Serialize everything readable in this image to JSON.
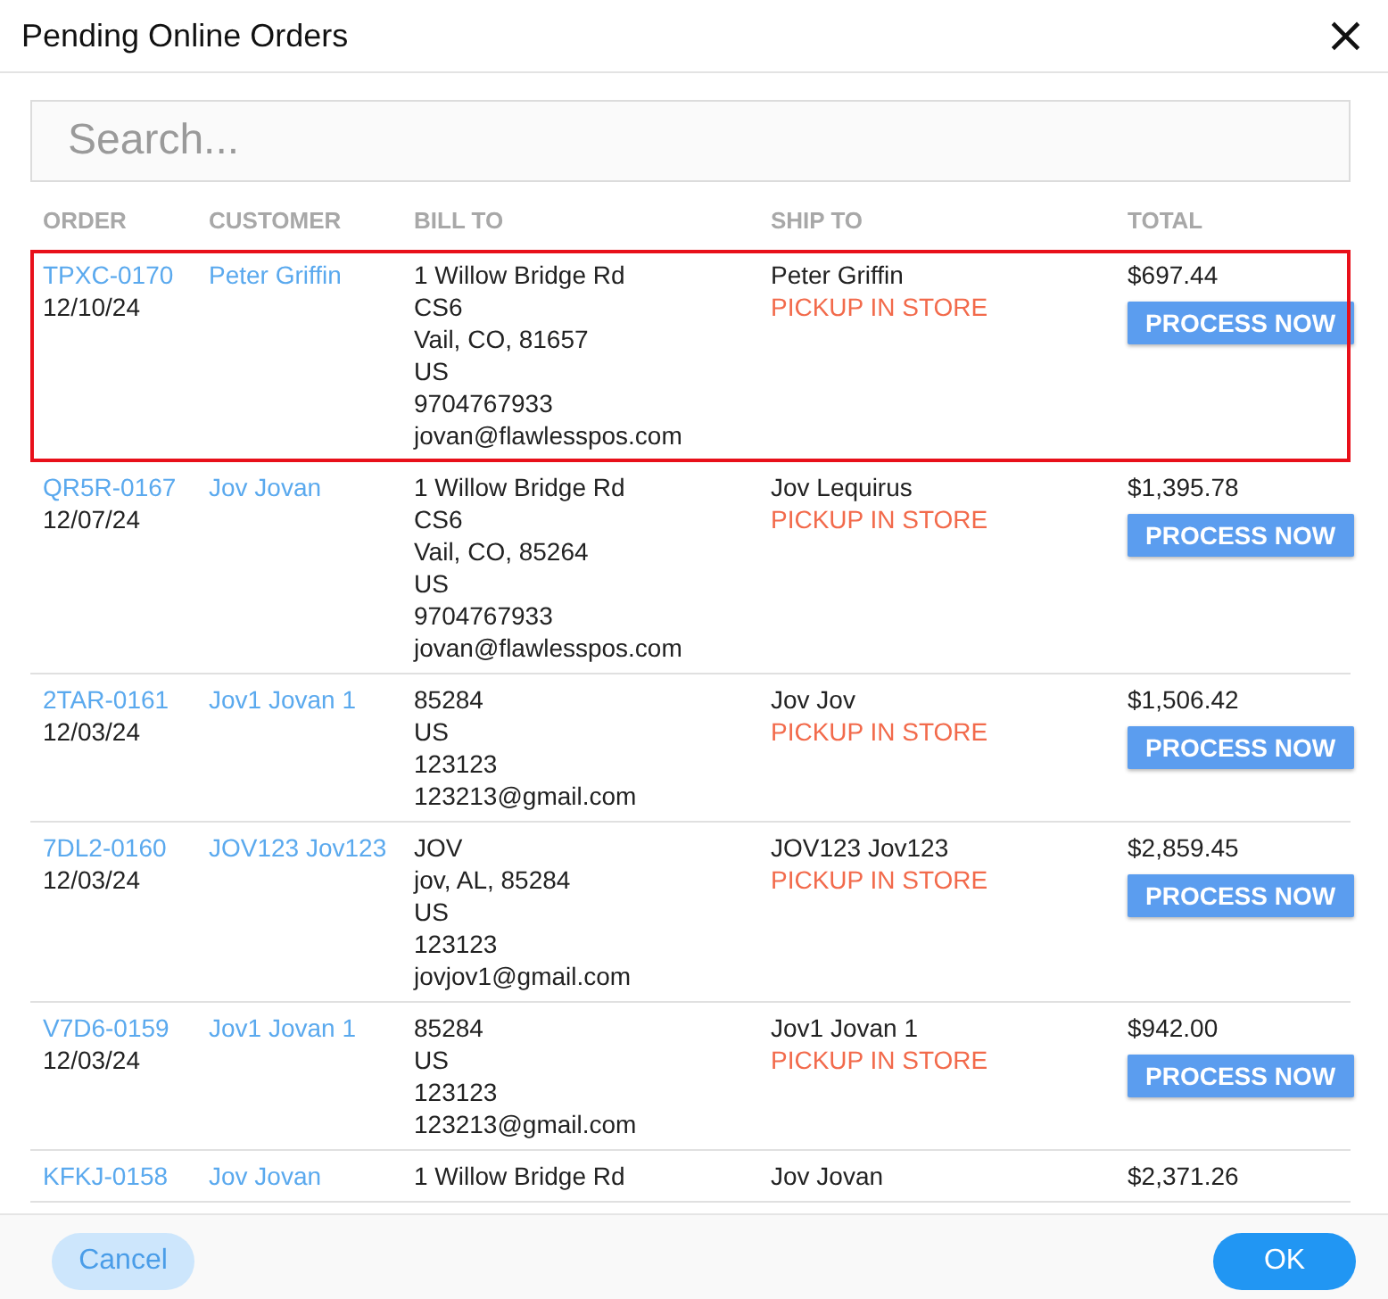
{
  "window": {
    "title": "Pending Online Orders",
    "close": "×"
  },
  "search": {
    "placeholder": "Search..."
  },
  "columns": [
    "ORDER",
    "CUSTOMER",
    "BILL TO",
    "SHIP TO",
    "TOTAL"
  ],
  "orders": [
    {
      "number": "TPXC-0170",
      "date": "12/10/24",
      "customer": "Peter Griffin",
      "bill_to": [
        "1 Willow Bridge Rd",
        "CS6",
        "Vail, CO, 81657",
        "US",
        "9704767933",
        "jovan@flawlesspos.com"
      ],
      "ship_name": "Peter Griffin",
      "ship_method": "PICKUP IN STORE",
      "total": "$697.44",
      "action": "PROCESS NOW",
      "selected": true
    },
    {
      "number": "QR5R-0167",
      "date": "12/07/24",
      "customer": "Jov Jovan",
      "bill_to": [
        "1 Willow Bridge Rd",
        "CS6",
        "Vail, CO, 85264",
        "US",
        "9704767933",
        "jovan@flawlesspos.com"
      ],
      "ship_name": "Jov Lequirus",
      "ship_method": "PICKUP IN STORE",
      "total": "$1,395.78",
      "action": "PROCESS NOW",
      "selected": false
    },
    {
      "number": "2TAR-0161",
      "date": "12/03/24",
      "customer": "Jov1 Jovan 1",
      "bill_to": [
        "85284",
        "US",
        "123123",
        "123213@gmail.com"
      ],
      "ship_name": "Jov Jov",
      "ship_method": "PICKUP IN STORE",
      "total": "$1,506.42",
      "action": "PROCESS NOW",
      "selected": false
    },
    {
      "number": "7DL2-0160",
      "date": "12/03/24",
      "customer": "JOV123 Jov123",
      "bill_to": [
        "JOV",
        "jov, AL, 85284",
        "US",
        "123123",
        "jovjov1@gmail.com"
      ],
      "ship_name": "JOV123 Jov123",
      "ship_method": "PICKUP IN STORE",
      "total": "$2,859.45",
      "action": "PROCESS NOW",
      "selected": false
    },
    {
      "number": "V7D6-0159",
      "date": "12/03/24",
      "customer": "Jov1 Jovan 1",
      "bill_to": [
        "85284",
        "US",
        "123123",
        "123213@gmail.com"
      ],
      "ship_name": "Jov1 Jovan 1",
      "ship_method": "PICKUP IN STORE",
      "total": "$942.00",
      "action": "PROCESS NOW",
      "selected": false
    },
    {
      "number": "KFKJ-0158",
      "customer": "Jov Jovan",
      "bill_to": [
        "1 Willow Bridge Rd"
      ],
      "ship_name": "Jov Jovan",
      "total": "$2,371.26",
      "selected": false
    }
  ],
  "footer": {
    "cancel": "Cancel",
    "ok": "OK"
  }
}
